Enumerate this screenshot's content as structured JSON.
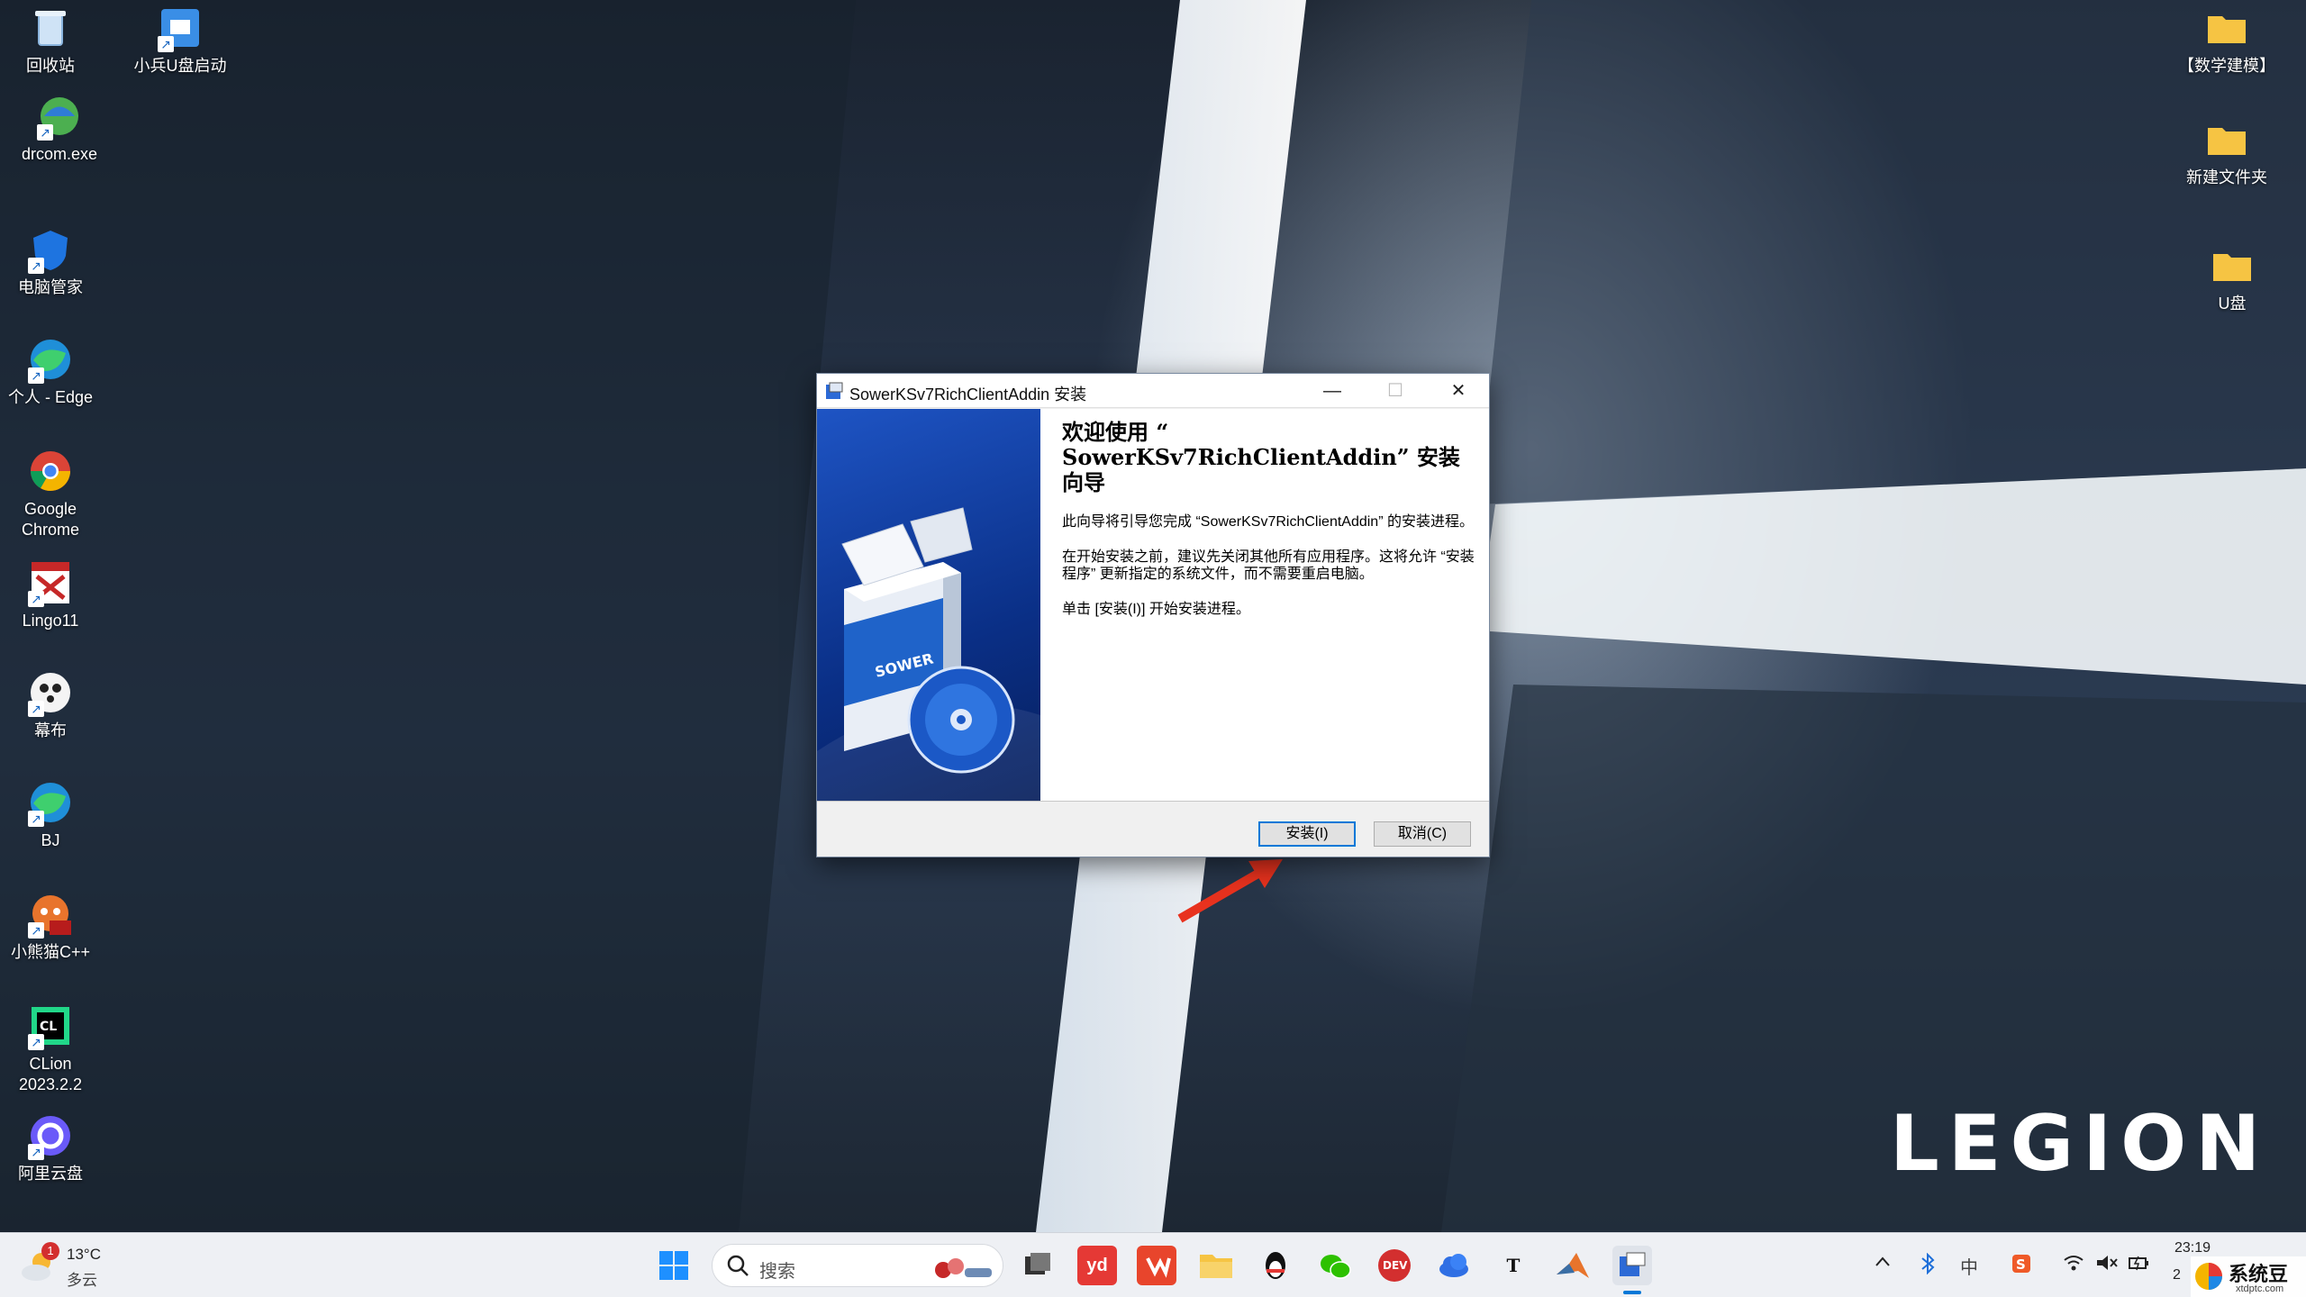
{
  "desktop": {
    "icons_left": [
      {
        "label": "回收站",
        "icon": "recycle-bin-icon"
      },
      {
        "label": "小兵U盘启动",
        "icon": "usb-boot-icon"
      },
      {
        "label": "drcom.exe",
        "icon": "drcom-icon"
      },
      {
        "label": "电脑管家",
        "icon": "pc-manager-icon"
      },
      {
        "label": "个人 - Edge",
        "icon": "edge-icon"
      },
      {
        "label": "Google Chrome",
        "icon": "chrome-icon"
      },
      {
        "label": "Lingo11",
        "icon": "lingo-icon"
      },
      {
        "label": "幕布",
        "icon": "mubu-icon"
      },
      {
        "label": "BJ",
        "icon": "edge-icon"
      },
      {
        "label": "小熊猫C++",
        "icon": "red-panda-cpp-icon"
      },
      {
        "label": "CLion 2023.2.2",
        "icon": "clion-icon"
      },
      {
        "label": "阿里云盘",
        "icon": "aliyun-drive-icon"
      }
    ],
    "icons_right": [
      {
        "label": "【数学建模】",
        "icon": "folder-icon"
      },
      {
        "label": "新建文件夹",
        "icon": "folder-icon"
      },
      {
        "label": "U盘",
        "icon": "folder-icon"
      }
    ],
    "brand_logo": "LEGION"
  },
  "dialog": {
    "title": "SowerKSv7RichClientAddin 安装",
    "minimize": "—",
    "maximize": "☐",
    "close": "✕",
    "heading": "欢迎使用 “ SowerKSv7RichClientAddin” 安装向导",
    "para1": "此向导将引导您完成 “SowerKSv7RichClientAddin” 的安装进程。",
    "para2": "在开始安装之前，建议先关闭其他所有应用程序。这将允许 “安装程序” 更新指定的系统文件，而不需要重启电脑。",
    "para3": "单击 [安装(I)] 开始安装进程。",
    "banner_box_text": "SOWER",
    "install_button": "安装(I)",
    "cancel_button": "取消(C)"
  },
  "taskbar": {
    "weather": {
      "temp": "13°C",
      "desc": "多云",
      "badge": "1"
    },
    "search_placeholder": "搜索",
    "apps": [
      {
        "name": "start-button",
        "label": ""
      },
      {
        "name": "task-view",
        "label": ""
      },
      {
        "name": "youdao-dict",
        "label": "yd"
      },
      {
        "name": "wps-app",
        "label": "W"
      },
      {
        "name": "file-explorer",
        "label": ""
      },
      {
        "name": "qq-app",
        "label": ""
      },
      {
        "name": "wechat-app",
        "label": ""
      },
      {
        "name": "devcpp-app",
        "label": "DEV"
      },
      {
        "name": "cloud-app",
        "label": ""
      },
      {
        "name": "typora-app",
        "label": "T"
      },
      {
        "name": "matlab-app",
        "label": ""
      },
      {
        "name": "installer-app",
        "label": ""
      }
    ],
    "tray": {
      "ime": "中",
      "time": "23:19",
      "date": "2"
    },
    "watermark": "系统豆",
    "watermark_url": "xtdptc.com"
  },
  "colors": {
    "accent": "#0078d7",
    "arrow": "#e8321e",
    "banner": "#1a4fb8"
  }
}
